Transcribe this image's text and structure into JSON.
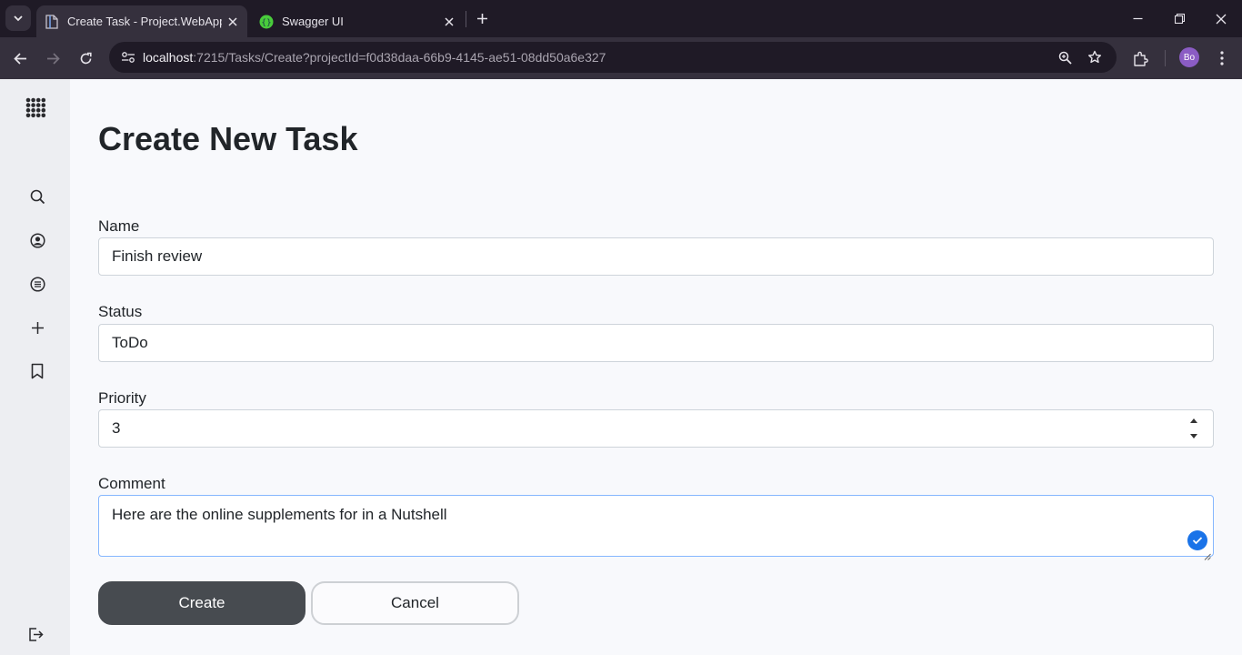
{
  "browser": {
    "tabs": [
      {
        "title": "Create Task - Project.WebApp",
        "active": true
      },
      {
        "title": "Swagger UI",
        "active": false
      }
    ],
    "url_host": "localhost",
    "url_path": ":7215/Tasks/Create?projectId=f0d38daa-66b9-4145-ae51-08dd50a6e327",
    "profile_initials": "Bo",
    "colors": {
      "tabbar": "#1f1a26",
      "toolbar": "#35303d",
      "avatar": "#8b5cc4"
    }
  },
  "sidebar": {
    "icons": [
      "apps-grid-icon",
      "search-icon",
      "account-icon",
      "list-icon",
      "plus-icon",
      "bookmark-icon",
      "logout-icon"
    ]
  },
  "form": {
    "title": "Create New Task",
    "name": {
      "label": "Name",
      "value": "Finish review"
    },
    "status": {
      "label": "Status",
      "value": "ToDo"
    },
    "priority": {
      "label": "Priority",
      "value": "3"
    },
    "comment": {
      "label": "Comment",
      "value": "Here are the online supplements for in a Nutshell"
    },
    "create_label": "Create",
    "cancel_label": "Cancel",
    "colors": {
      "primary_button": "#474b50",
      "focus_border": "#86b7fe",
      "check_badge": "#1a73e8"
    }
  }
}
